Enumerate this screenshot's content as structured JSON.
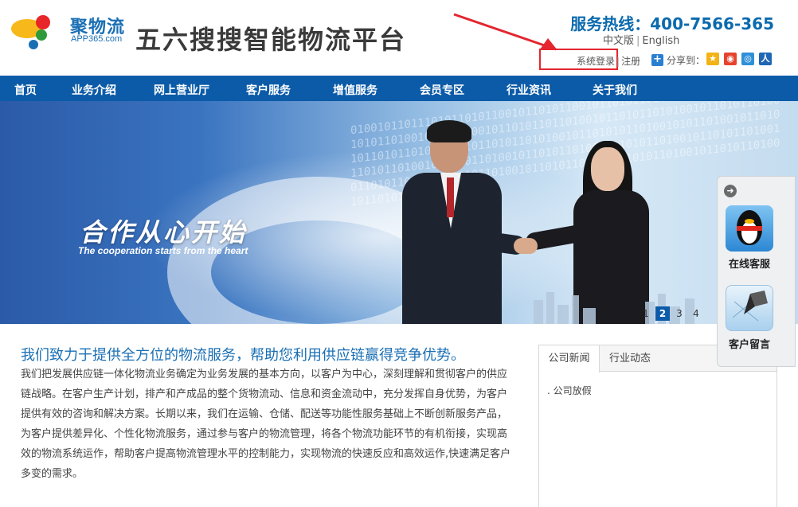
{
  "header": {
    "logo_brand": "聚物流",
    "logo_sub": "APP365.com",
    "site_title": "五六搜搜智能物流平台",
    "hotline": "服务热线：400-7566-365",
    "lang_cn": "中文版",
    "lang_sep": "|",
    "lang_en": "English",
    "login": "系统登录",
    "login_sep": "|",
    "register": "注册",
    "share_label": "分享到：",
    "share_icons": [
      "qzone-icon",
      "weibo-icon",
      "tencent-weibo-icon",
      "renren-icon"
    ],
    "highlight_color": "#e3262f"
  },
  "nav": {
    "items": [
      "首页",
      "业务介绍",
      "网上营业厅",
      "客户服务",
      "增值服务",
      "会员专区",
      "行业资讯",
      "关于我们"
    ],
    "background": "#0b5ba8"
  },
  "banner": {
    "slogan": "合作从心开始",
    "slogan_en": "The cooperation starts from the heart",
    "pages": [
      "1",
      "2",
      "3",
      "4"
    ],
    "active_page": "2"
  },
  "intro": {
    "title": "我们致力于提供全方位的物流服务，帮助您利用供应链赢得竞争优势。",
    "text": "我们把发展供应链一体化物流业务确定为业务发展的基本方向，以客户为中心，深刻理解和贯彻客户的供应链战略。在客户生产计划，排产和产成品的整个货物流动、信息和资金流动中，充分发挥自身优势，为客户提供有效的咨询和解决方案。长期以来，我们在运输、仓储、配送等功能性服务基础上不断创新服务产品，为客户提供差异化、个性化物流服务，通过参与客户的物流管理，将各个物流功能环节的有机衔接，实现高效的物流系统运作，帮助客户提高物流管理水平的控制能力，实现物流的快速反应和高效运作,快速满足客户多变的需求。"
  },
  "news": {
    "tabs": [
      "公司新闻",
      "行业动态"
    ],
    "items": [
      ". 公司放假"
    ]
  },
  "float_widget": {
    "online_service": "在线客服",
    "message": "客户留言"
  }
}
